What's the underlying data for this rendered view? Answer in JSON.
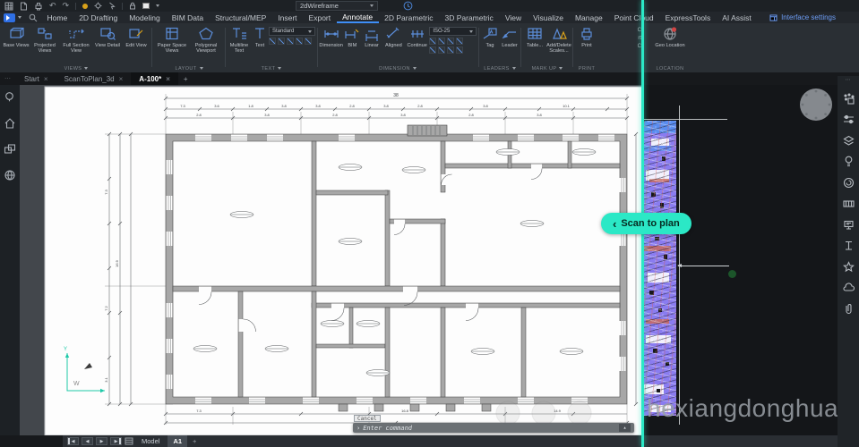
{
  "titlebar": {
    "view_style": "2dWireframe"
  },
  "menubar": {
    "items": [
      "Home",
      "2D Drafting",
      "Modeling",
      "BIM Data",
      "Structural/MEP",
      "Insert",
      "Export",
      "Annotate",
      "2D Parametric",
      "3D Parametric",
      "View",
      "Visualize",
      "Manage",
      "Point Cloud",
      "ExpressTools",
      "AI Assist"
    ],
    "active_item": "Annotate",
    "interface_settings": "Interface settings"
  },
  "ribbon": {
    "views": {
      "name": "Views",
      "buttons": [
        "Base Views",
        "Projected Views",
        "Full Section View",
        "View Detail",
        "Edit View"
      ]
    },
    "layout": {
      "name": "Layout",
      "buttons": [
        "Paper Space Views",
        "Polygonal Viewport"
      ]
    },
    "text": {
      "name": "Text",
      "buttons": [
        "Multiline Text",
        "Text"
      ],
      "style": "Standard"
    },
    "dimension": {
      "name": "Dimension",
      "buttons": [
        "Dimension",
        "BIM",
        "Linear",
        "Aligned",
        "Continue"
      ],
      "style": "ISO-25"
    },
    "leaders": {
      "name": "Leaders",
      "buttons": [
        "Tag",
        "Leader"
      ]
    },
    "markup": {
      "name": "Mark Up",
      "buttons": [
        "Table...",
        "Add/Delete Scales..."
      ]
    },
    "print": {
      "name": "Print",
      "buttons": [
        "Print"
      ]
    },
    "location": {
      "name": "Location",
      "buttons": [
        "Geo Location"
      ]
    },
    "clipped_fragments": [
      "C",
      "rt",
      "C"
    ]
  },
  "doc_tabs": {
    "tabs": [
      "Start",
      "ScanToPlan_3d",
      "A-100*"
    ],
    "active_tab": "A-100*",
    "add": "+"
  },
  "scan": {
    "label": "Scan to plan"
  },
  "command": {
    "history": "Cancel",
    "prompt": "Enter command"
  },
  "statusbar": {
    "tabs": [
      "Model",
      "A1"
    ],
    "active_tab": "A1",
    "add": "+"
  },
  "watermark": {
    "text": "hexiangdonghua"
  },
  "drawing": {
    "total_dim": "38",
    "top_dims": [
      "7.3",
      "3.6",
      "1.8",
      "3.8",
      "3.8",
      "2.8",
      "3.8",
      "2.8",
      "3.8",
      "10.1"
    ],
    "top_dims_2": [
      "2.8",
      "3.8",
      "2.8",
      "3.8",
      "2.8",
      "3.8"
    ],
    "left_dims": [
      "7.3",
      "7.2",
      "16.9",
      "3.1"
    ],
    "bottom_dims": [
      "7.3",
      "16.8",
      "14.9"
    ],
    "ucs": {
      "y_axis": "Y",
      "origin": "W"
    }
  },
  "icons": {
    "close": "×",
    "plus": "+",
    "prompt_prefix": "›",
    "collapse_caret": "▴",
    "chevron_left": "‹",
    "undo": "↶",
    "redo": "↷",
    "tri_left": "◀",
    "tri_right": "▶",
    "drag_dots": "⋯"
  },
  "colors": {
    "accent_teal": "#2BE8C6",
    "accent_blue": "#3E8EF7",
    "icon_blue": "#5B8DD9"
  }
}
